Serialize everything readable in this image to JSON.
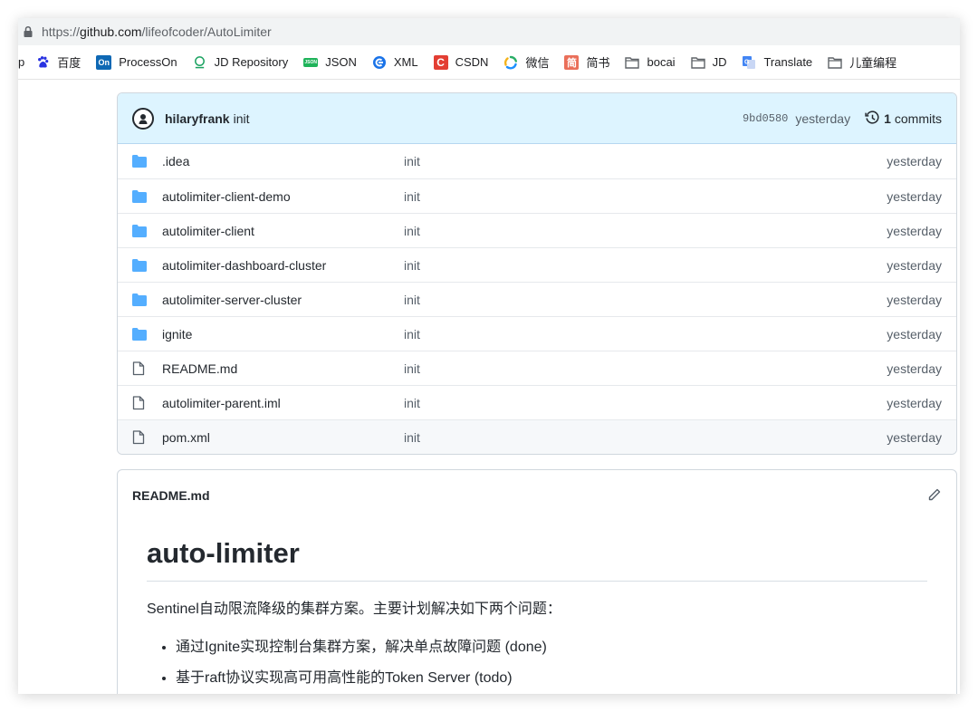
{
  "browser": {
    "url_prefix": "https://",
    "url_host": "github.com",
    "url_path": "/lifeofcoder/AutoLimiter",
    "bookmarks": [
      {
        "label": "p",
        "icon": "cutoff"
      },
      {
        "label": "百度",
        "icon": "baidu-paw-icon"
      },
      {
        "label": "ProcessOn",
        "icon": "processon-icon",
        "badge": "On"
      },
      {
        "label": "JD Repository",
        "icon": "jd-repo-icon"
      },
      {
        "label": "JSON",
        "icon": "json-icon"
      },
      {
        "label": "XML",
        "icon": "xml-icon"
      },
      {
        "label": "CSDN",
        "icon": "csdn-icon",
        "badge": "C"
      },
      {
        "label": "微信",
        "icon": "wechat-icon"
      },
      {
        "label": "简书",
        "icon": "jianshu-icon",
        "badge": "简"
      },
      {
        "label": "bocai",
        "icon": "folder-icon"
      },
      {
        "label": "JD",
        "icon": "folder-icon"
      },
      {
        "label": "Translate",
        "icon": "translate-icon"
      },
      {
        "label": "儿童编程",
        "icon": "folder-icon"
      }
    ]
  },
  "commit": {
    "author": "hilaryfrank",
    "message": "init",
    "sha": "9bd0580",
    "when": "yesterday",
    "count": "1",
    "count_label": "commits"
  },
  "files": [
    {
      "name": ".idea",
      "type": "dir",
      "message": "init",
      "age": "yesterday"
    },
    {
      "name": "autolimiter-client-demo",
      "type": "dir",
      "message": "init",
      "age": "yesterday"
    },
    {
      "name": "autolimiter-client",
      "type": "dir",
      "message": "init",
      "age": "yesterday"
    },
    {
      "name": "autolimiter-dashboard-cluster",
      "type": "dir",
      "message": "init",
      "age": "yesterday"
    },
    {
      "name": "autolimiter-server-cluster",
      "type": "dir",
      "message": "init",
      "age": "yesterday"
    },
    {
      "name": "ignite",
      "type": "dir",
      "message": "init",
      "age": "yesterday"
    },
    {
      "name": "README.md",
      "type": "file",
      "message": "init",
      "age": "yesterday"
    },
    {
      "name": "autolimiter-parent.iml",
      "type": "file",
      "message": "init",
      "age": "yesterday"
    },
    {
      "name": "pom.xml",
      "type": "file",
      "message": "init",
      "age": "yesterday"
    }
  ],
  "readme": {
    "filename": "README.md",
    "title": "auto-limiter",
    "intro": "Sentinel自动限流降级的集群方案。主要计划解决如下两个问题：",
    "items": [
      "通过Ignite实现控制台集群方案，解决单点故障问题 (done)",
      "基于raft协议实现高可用高性能的Token Server (todo)"
    ]
  },
  "colors": {
    "folder": "#54aeff",
    "commit_bar_bg": "#ddf4ff",
    "csdn_red": "#e33e33",
    "jianshu_red": "#ea6f5a",
    "processon_blue": "#0e68b4"
  }
}
